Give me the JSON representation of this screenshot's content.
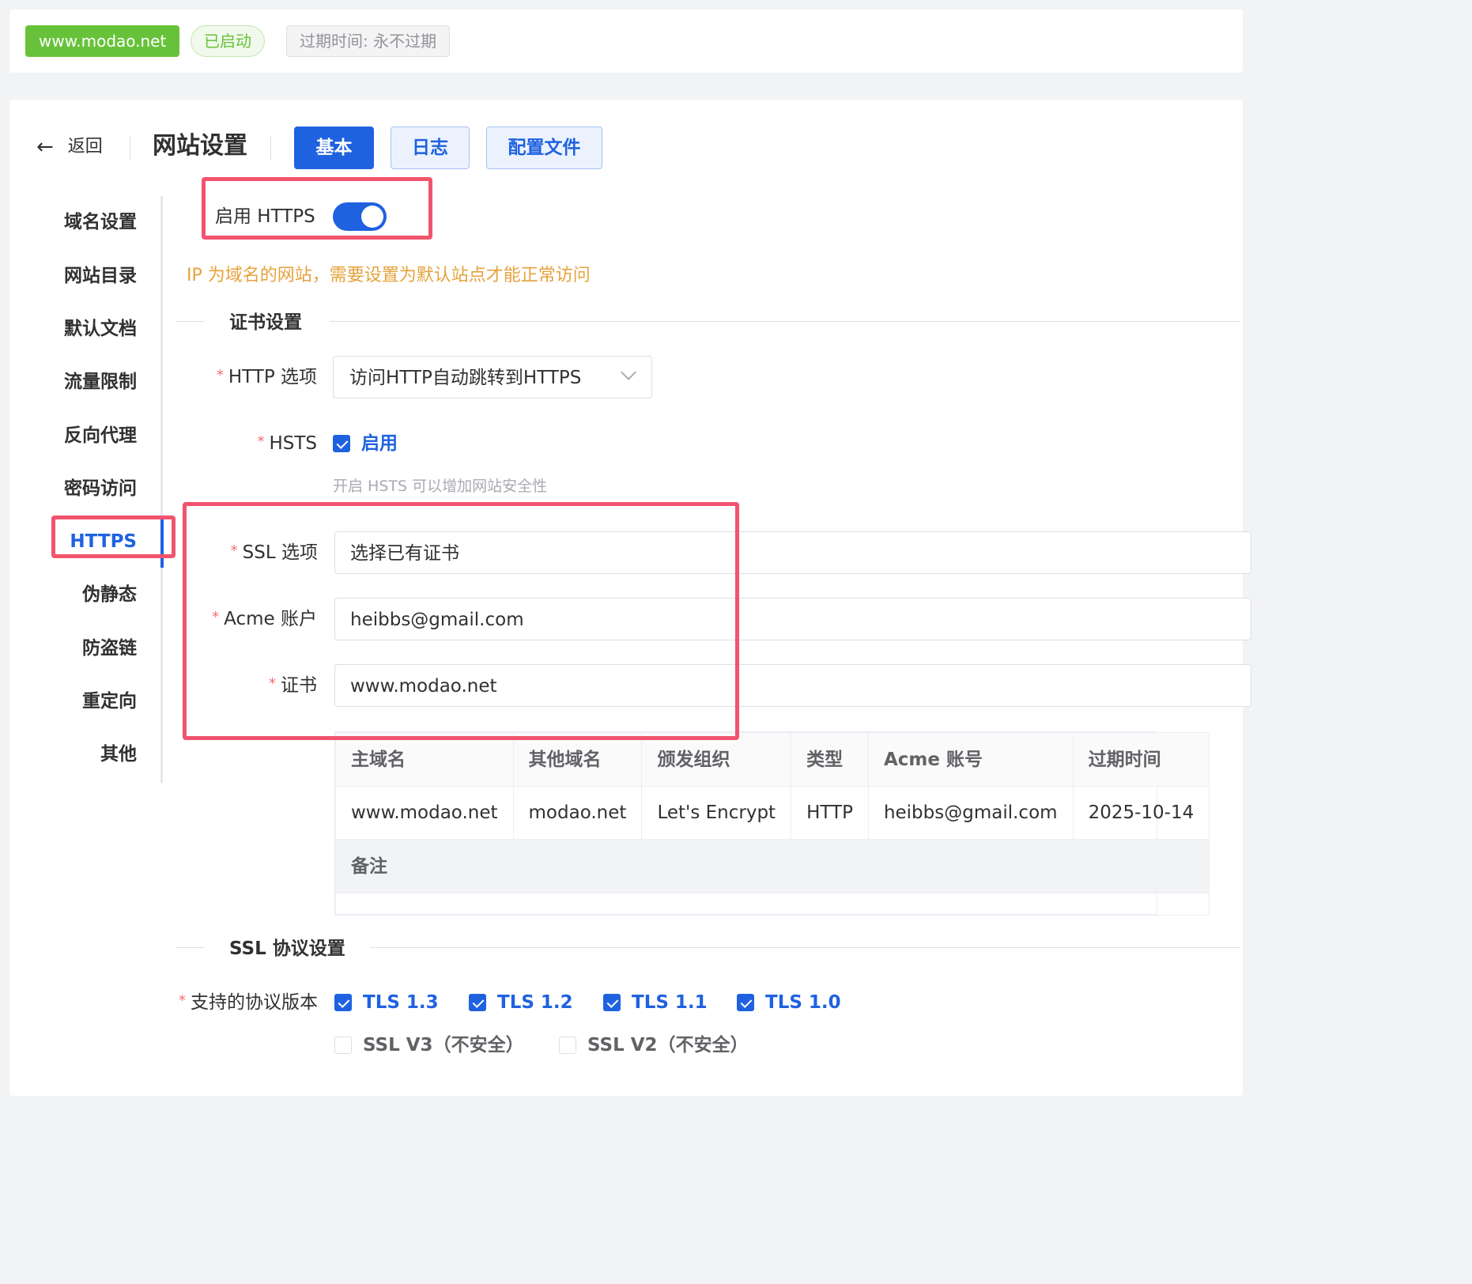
{
  "header": {
    "domain_tag": "www.modao.net",
    "status_tag": "已启动",
    "expire_tag": "过期时间: 永不过期"
  },
  "toolbar": {
    "back_label": "返回",
    "page_title": "网站设置",
    "tabs": [
      {
        "label": "基本",
        "active": true
      },
      {
        "label": "日志",
        "active": false
      },
      {
        "label": "配置文件",
        "active": false
      }
    ]
  },
  "sidebar": {
    "items": [
      {
        "label": "域名设置"
      },
      {
        "label": "网站目录"
      },
      {
        "label": "默认文档"
      },
      {
        "label": "流量限制"
      },
      {
        "label": "反向代理"
      },
      {
        "label": "密码访问"
      },
      {
        "label": "HTTPS",
        "active": true
      },
      {
        "label": "伪静态"
      },
      {
        "label": "防盗链"
      },
      {
        "label": "重定向"
      },
      {
        "label": "其他"
      }
    ]
  },
  "https": {
    "enable_label": "启用 HTTPS",
    "enabled": true,
    "warning": "IP 为域名的网站，需要设置为默认站点才能正常访问"
  },
  "cert_section": {
    "title": "证书设置",
    "http_option_label": "HTTP 选项",
    "http_option_value": "访问HTTP自动跳转到HTTPS",
    "hsts_label": "HSTS",
    "hsts_checkbox_label": "启用",
    "hsts_checked": true,
    "hsts_hint": "开启 HSTS 可以增加网站安全性",
    "ssl_option_label": "SSL 选项",
    "ssl_option_value": "选择已有证书",
    "acme_label": "Acme 账户",
    "acme_value": "heibbs@gmail.com",
    "cert_label": "证书",
    "cert_value": "www.modao.net"
  },
  "cert_table": {
    "headers": [
      "主域名",
      "其他域名",
      "颁发组织",
      "类型",
      "Acme 账号",
      "过期时间"
    ],
    "row": [
      "www.modao.net",
      "modao.net",
      "Let's Encrypt",
      "HTTP",
      "heibbs@gmail.com",
      "2025-10-14"
    ],
    "remark_label": "备注",
    "remark_value": ""
  },
  "ssl_protocol": {
    "title": "SSL 协议设置",
    "versions_label": "支持的协议版本",
    "versions": [
      {
        "label": "TLS 1.3",
        "checked": true
      },
      {
        "label": "TLS 1.2",
        "checked": true
      },
      {
        "label": "TLS 1.1",
        "checked": true
      },
      {
        "label": "TLS 1.0",
        "checked": true
      },
      {
        "label": "SSL V3（不安全）",
        "checked": false
      },
      {
        "label": "SSL V2（不安全）",
        "checked": false
      }
    ]
  },
  "colors": {
    "primary": "#1f62e0",
    "success": "#67c23a",
    "warning": "#e6a23c",
    "highlight": "#f2536d"
  }
}
